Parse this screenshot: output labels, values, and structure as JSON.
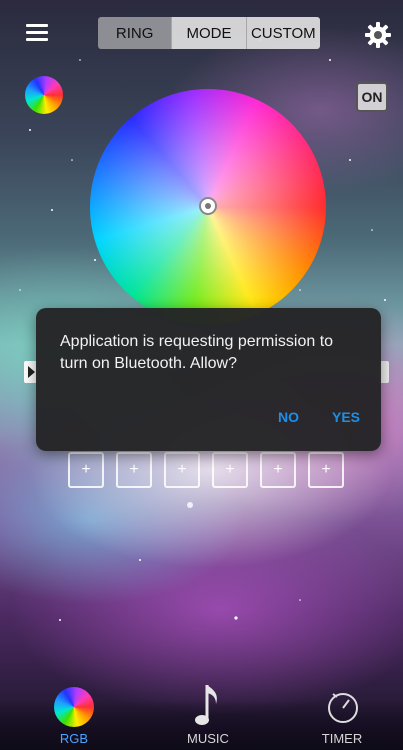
{
  "header": {
    "tabs": [
      {
        "label": "RING"
      },
      {
        "label": "MODE"
      },
      {
        "label": "CUSTOM"
      }
    ],
    "menu_icon": "hamburger-menu-icon",
    "settings_icon": "gear-icon"
  },
  "controls": {
    "power_label": "ON",
    "preset_slot_label": "+"
  },
  "dialog": {
    "message": "Application is requesting permission to turn on Bluetooth. Allow?",
    "no_label": "NO",
    "yes_label": "YES"
  },
  "nav": {
    "items": [
      {
        "label": "RGB",
        "icon": "color-wheel-icon"
      },
      {
        "label": "MUSIC",
        "icon": "music-note-icon"
      },
      {
        "label": "TIMER",
        "icon": "timer-icon"
      }
    ]
  },
  "colors": {
    "accent": "#1e8fe6",
    "dialog_bg": "#242426",
    "nav_active": "#4ea3ff",
    "nav_inactive": "#d6d6d6"
  }
}
